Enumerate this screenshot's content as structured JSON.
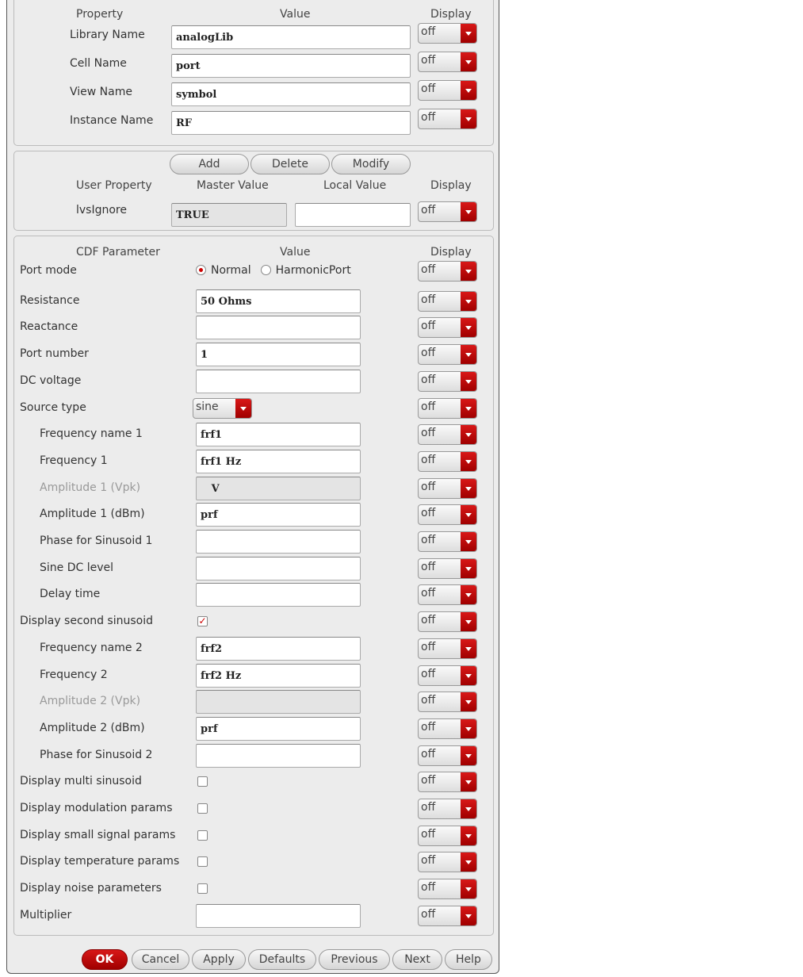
{
  "properties": {
    "headers": {
      "property": "Property",
      "value": "Value",
      "display": "Display"
    },
    "rows": [
      {
        "label": "Library Name",
        "value": "analogLib",
        "display": "off"
      },
      {
        "label": "Cell Name",
        "value": "port",
        "display": "off"
      },
      {
        "label": "View Name",
        "value": "symbol",
        "display": "off"
      },
      {
        "label": "Instance Name",
        "value": "RF",
        "display": "off"
      }
    ]
  },
  "user_props": {
    "buttons": {
      "add": "Add",
      "delete": "Delete",
      "modify": "Modify"
    },
    "headers": {
      "user_property": "User Property",
      "master_value": "Master Value",
      "local_value": "Local Value",
      "display": "Display"
    },
    "rows": [
      {
        "label": "lvsIgnore",
        "master": "TRUE",
        "local": "",
        "display": "off"
      }
    ]
  },
  "cdf": {
    "headers": {
      "parameter": "CDF Parameter",
      "value": "Value",
      "display": "Display"
    },
    "rows": [
      {
        "label": "Port mode",
        "type": "radio",
        "options": [
          "Normal",
          "HarmonicPort"
        ],
        "selected": "Normal",
        "display": "off"
      },
      {
        "label": "Resistance",
        "type": "text",
        "value": "50 Ohms",
        "display": "off"
      },
      {
        "label": "Reactance",
        "type": "text",
        "value": "",
        "display": "off"
      },
      {
        "label": "Port number",
        "type": "text",
        "value": "1",
        "display": "off"
      },
      {
        "label": "DC voltage",
        "type": "text",
        "value": "",
        "display": "off"
      },
      {
        "label": "Source type",
        "type": "select",
        "value": "sine",
        "display": "off"
      },
      {
        "label": "Frequency name 1",
        "type": "text",
        "value": "frf1",
        "indent": true,
        "display": "off"
      },
      {
        "label": "Frequency 1",
        "type": "text",
        "value": "frf1 Hz",
        "indent": true,
        "display": "off"
      },
      {
        "label": "Amplitude 1 (Vpk)",
        "type": "text",
        "value": "   V",
        "indent": true,
        "disabled": true,
        "display": "off"
      },
      {
        "label": "Amplitude 1 (dBm)",
        "type": "text",
        "value": "prf",
        "indent": true,
        "display": "off"
      },
      {
        "label": "Phase for Sinusoid 1",
        "type": "text",
        "value": "",
        "indent": true,
        "display": "off"
      },
      {
        "label": "Sine DC level",
        "type": "text",
        "value": "",
        "indent": true,
        "display": "off"
      },
      {
        "label": "Delay time",
        "type": "text",
        "value": "",
        "indent": true,
        "display": "off"
      },
      {
        "label": "Display second sinusoid",
        "type": "checkbox",
        "checked": true,
        "display": "off"
      },
      {
        "label": "Frequency name 2",
        "type": "text",
        "value": "frf2",
        "indent": true,
        "display": "off"
      },
      {
        "label": "Frequency 2",
        "type": "text",
        "value": "frf2 Hz",
        "indent": true,
        "display": "off"
      },
      {
        "label": "Amplitude 2 (Vpk)",
        "type": "text",
        "value": "",
        "indent": true,
        "disabled": true,
        "display": "off"
      },
      {
        "label": "Amplitude 2 (dBm)",
        "type": "text",
        "value": "prf",
        "indent": true,
        "display": "off"
      },
      {
        "label": "Phase for Sinusoid 2",
        "type": "text",
        "value": "",
        "indent": true,
        "display": "off"
      },
      {
        "label": "Display multi sinusoid",
        "type": "checkbox",
        "checked": false,
        "display": "off"
      },
      {
        "label": "Display modulation params",
        "type": "checkbox",
        "checked": false,
        "display": "off"
      },
      {
        "label": "Display small signal params",
        "type": "checkbox",
        "checked": false,
        "display": "off"
      },
      {
        "label": "Display temperature params",
        "type": "checkbox",
        "checked": false,
        "display": "off"
      },
      {
        "label": "Display noise parameters",
        "type": "checkbox",
        "checked": false,
        "display": "off"
      },
      {
        "label": "Multiplier",
        "type": "text",
        "value": "",
        "display": "off"
      }
    ]
  },
  "footer": {
    "ok": "OK",
    "cancel": "Cancel",
    "apply": "Apply",
    "defaults": "Defaults",
    "previous": "Previous",
    "next": "Next",
    "help": "Help"
  }
}
